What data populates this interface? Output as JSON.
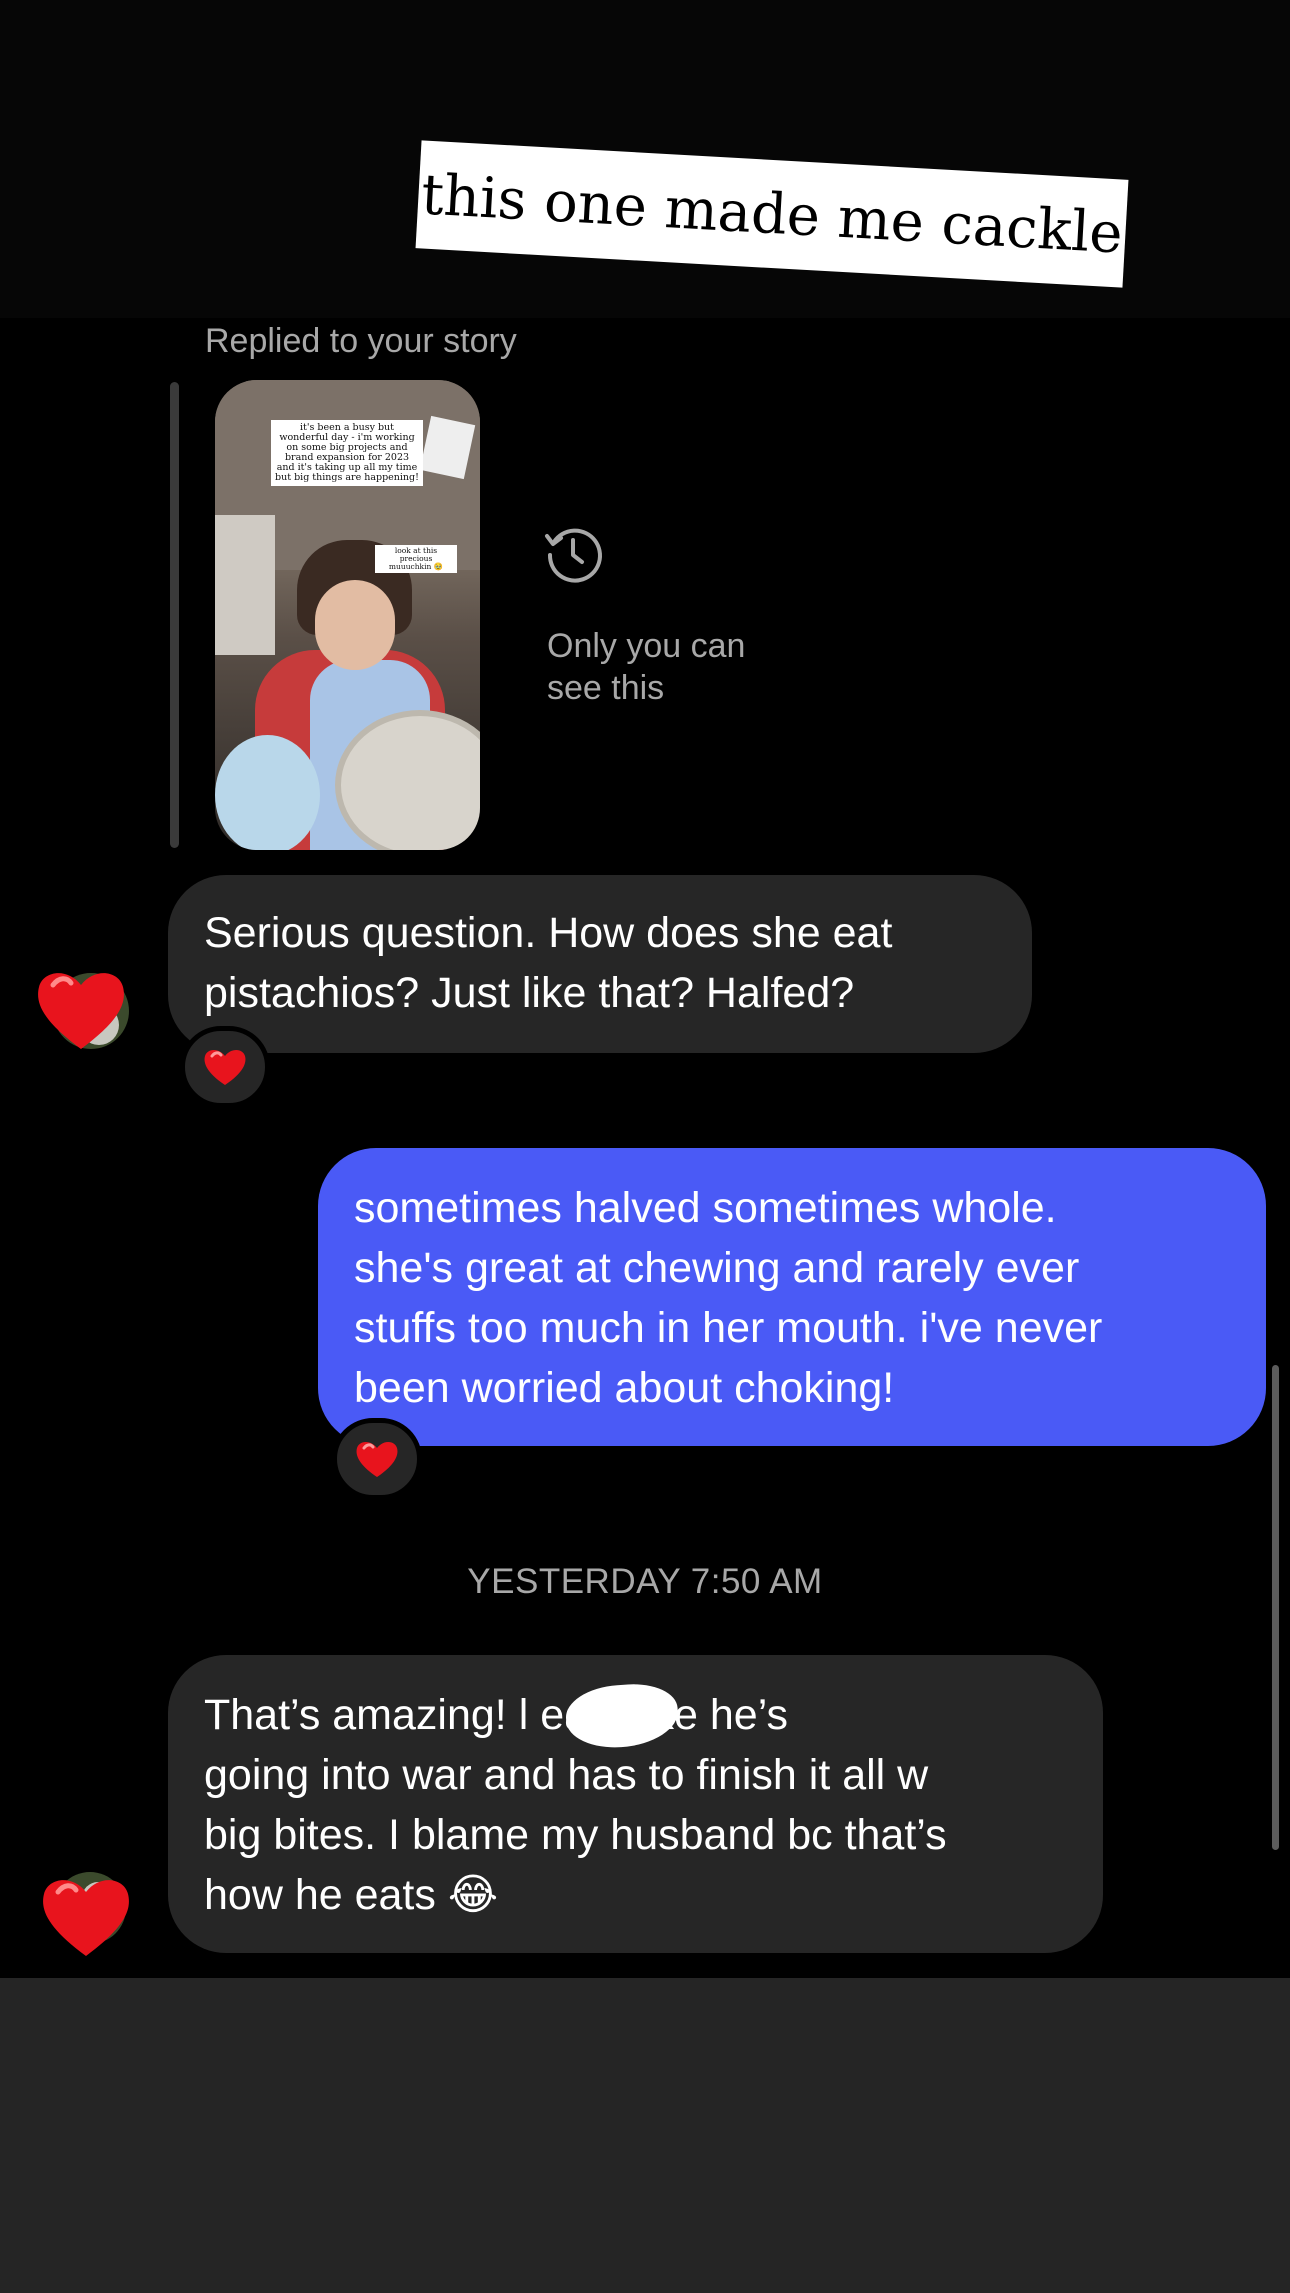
{
  "caption": {
    "text": "this one made me cackle"
  },
  "story_reply": {
    "label": "Replied to your story",
    "thumbnail_note_1": "it's been a busy but wonderful day - i'm working on some big projects and brand expansion for 2023 and it's taking up all my time but big things are happening!",
    "thumbnail_note_2": "look at this precious muuuchkin 🥹",
    "privacy_text": "Only you can see this",
    "privacy_icon": "history-clock-icon"
  },
  "messages": [
    {
      "direction": "incoming",
      "lines": [
        "Serious question. How does she eat",
        "pistachios? Just like that? Halfed?"
      ],
      "reaction": "❤️"
    },
    {
      "direction": "outgoing",
      "lines": [
        "sometimes halved sometimes whole.",
        "she's great at chewing and rarely ever",
        "stuffs too much in her mouth. i've never",
        "been worried about choking!"
      ],
      "reaction": "❤️"
    },
    {
      "direction": "incoming",
      "lines": [
        "That’s amazing! l          eats like he’s",
        "going into war and has to finish it all  w",
        "big bites. I blame my husband bc that’s",
        "how he eats 😂"
      ]
    }
  ],
  "timestamp": "YESTERDAY 7:50 AM",
  "colors": {
    "background": "#000000",
    "incoming_bubble": "#262626",
    "outgoing_bubble": "#4a5af6",
    "secondary_text": "#a8a8a8",
    "heart": "#e8141d"
  }
}
